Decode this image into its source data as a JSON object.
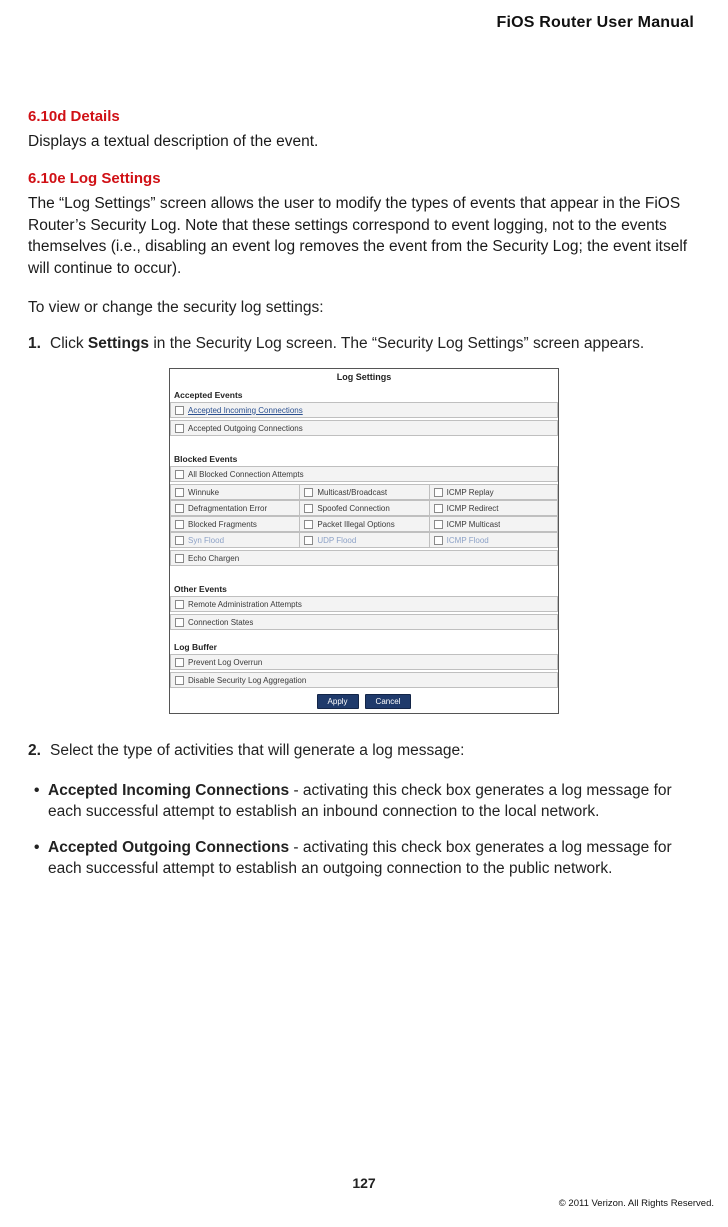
{
  "doc_title": "FiOS Router User Manual",
  "section_610d": {
    "heading": "6.10d  Details",
    "body": "Displays a textual description of the event."
  },
  "section_610e": {
    "heading": "6.10e  Log Settings",
    "body": "The “Log Settings” screen allows the user to modify the types of events that appear in the FiOS Router’s Security Log. Note that these settings correspond to event logging, not to the events themselves (i.e., disabling an event log removes the event from the Security Log; the event itself will continue to occur).",
    "instruction": "To view or change the security log settings:",
    "step1_num": "1.",
    "step1_pre": "Click ",
    "step1_bold": "Settings",
    "step1_post": " in the Security Log screen. The “Security Log Settings” screen appears.",
    "step2_num": "2.",
    "step2_text": "Select the type of activities that will generate a log message:",
    "bullet1_bold": "Accepted Incoming Connections",
    "bullet1_rest": " - activating this check box generates a log message for each successful attempt to establish an inbound connection to the local network.",
    "bullet2_bold": "Accepted Outgoing Connections",
    "bullet2_rest": " - activating this check box generates a log message for each successful attempt to establish an outgoing connection to the public network."
  },
  "shot": {
    "title": "Log Settings",
    "accepted_hdr": "Accepted Events",
    "accepted_rows": [
      "Accepted Incoming Connections",
      "Accepted Outgoing Connections"
    ],
    "blocked_hdr": "Blocked Events",
    "blocked_full": "All Blocked Connection Attempts",
    "blocked_grid": [
      [
        "Winnuke",
        "Multicast/Broadcast",
        "ICMP Replay"
      ],
      [
        "Defragmentation Error",
        "Spoofed Connection",
        "ICMP Redirect"
      ],
      [
        "Blocked Fragments",
        "Packet Illegal Options",
        "ICMP Multicast"
      ],
      [
        "Syn Flood",
        "UDP Flood",
        "ICMP Flood"
      ]
    ],
    "blocked_tail": "Echo Chargen",
    "other_hdr": "Other Events",
    "other_rows": [
      "Remote Administration Attempts",
      "Connection States"
    ],
    "buffer_hdr": "Log Buffer",
    "buffer_rows": [
      "Prevent Log Overrun",
      "Disable Security Log Aggregation"
    ],
    "apply": "Apply",
    "cancel": "Cancel"
  },
  "page_number": "127",
  "copyright": "© 2011 Verizon. All Rights Reserved."
}
